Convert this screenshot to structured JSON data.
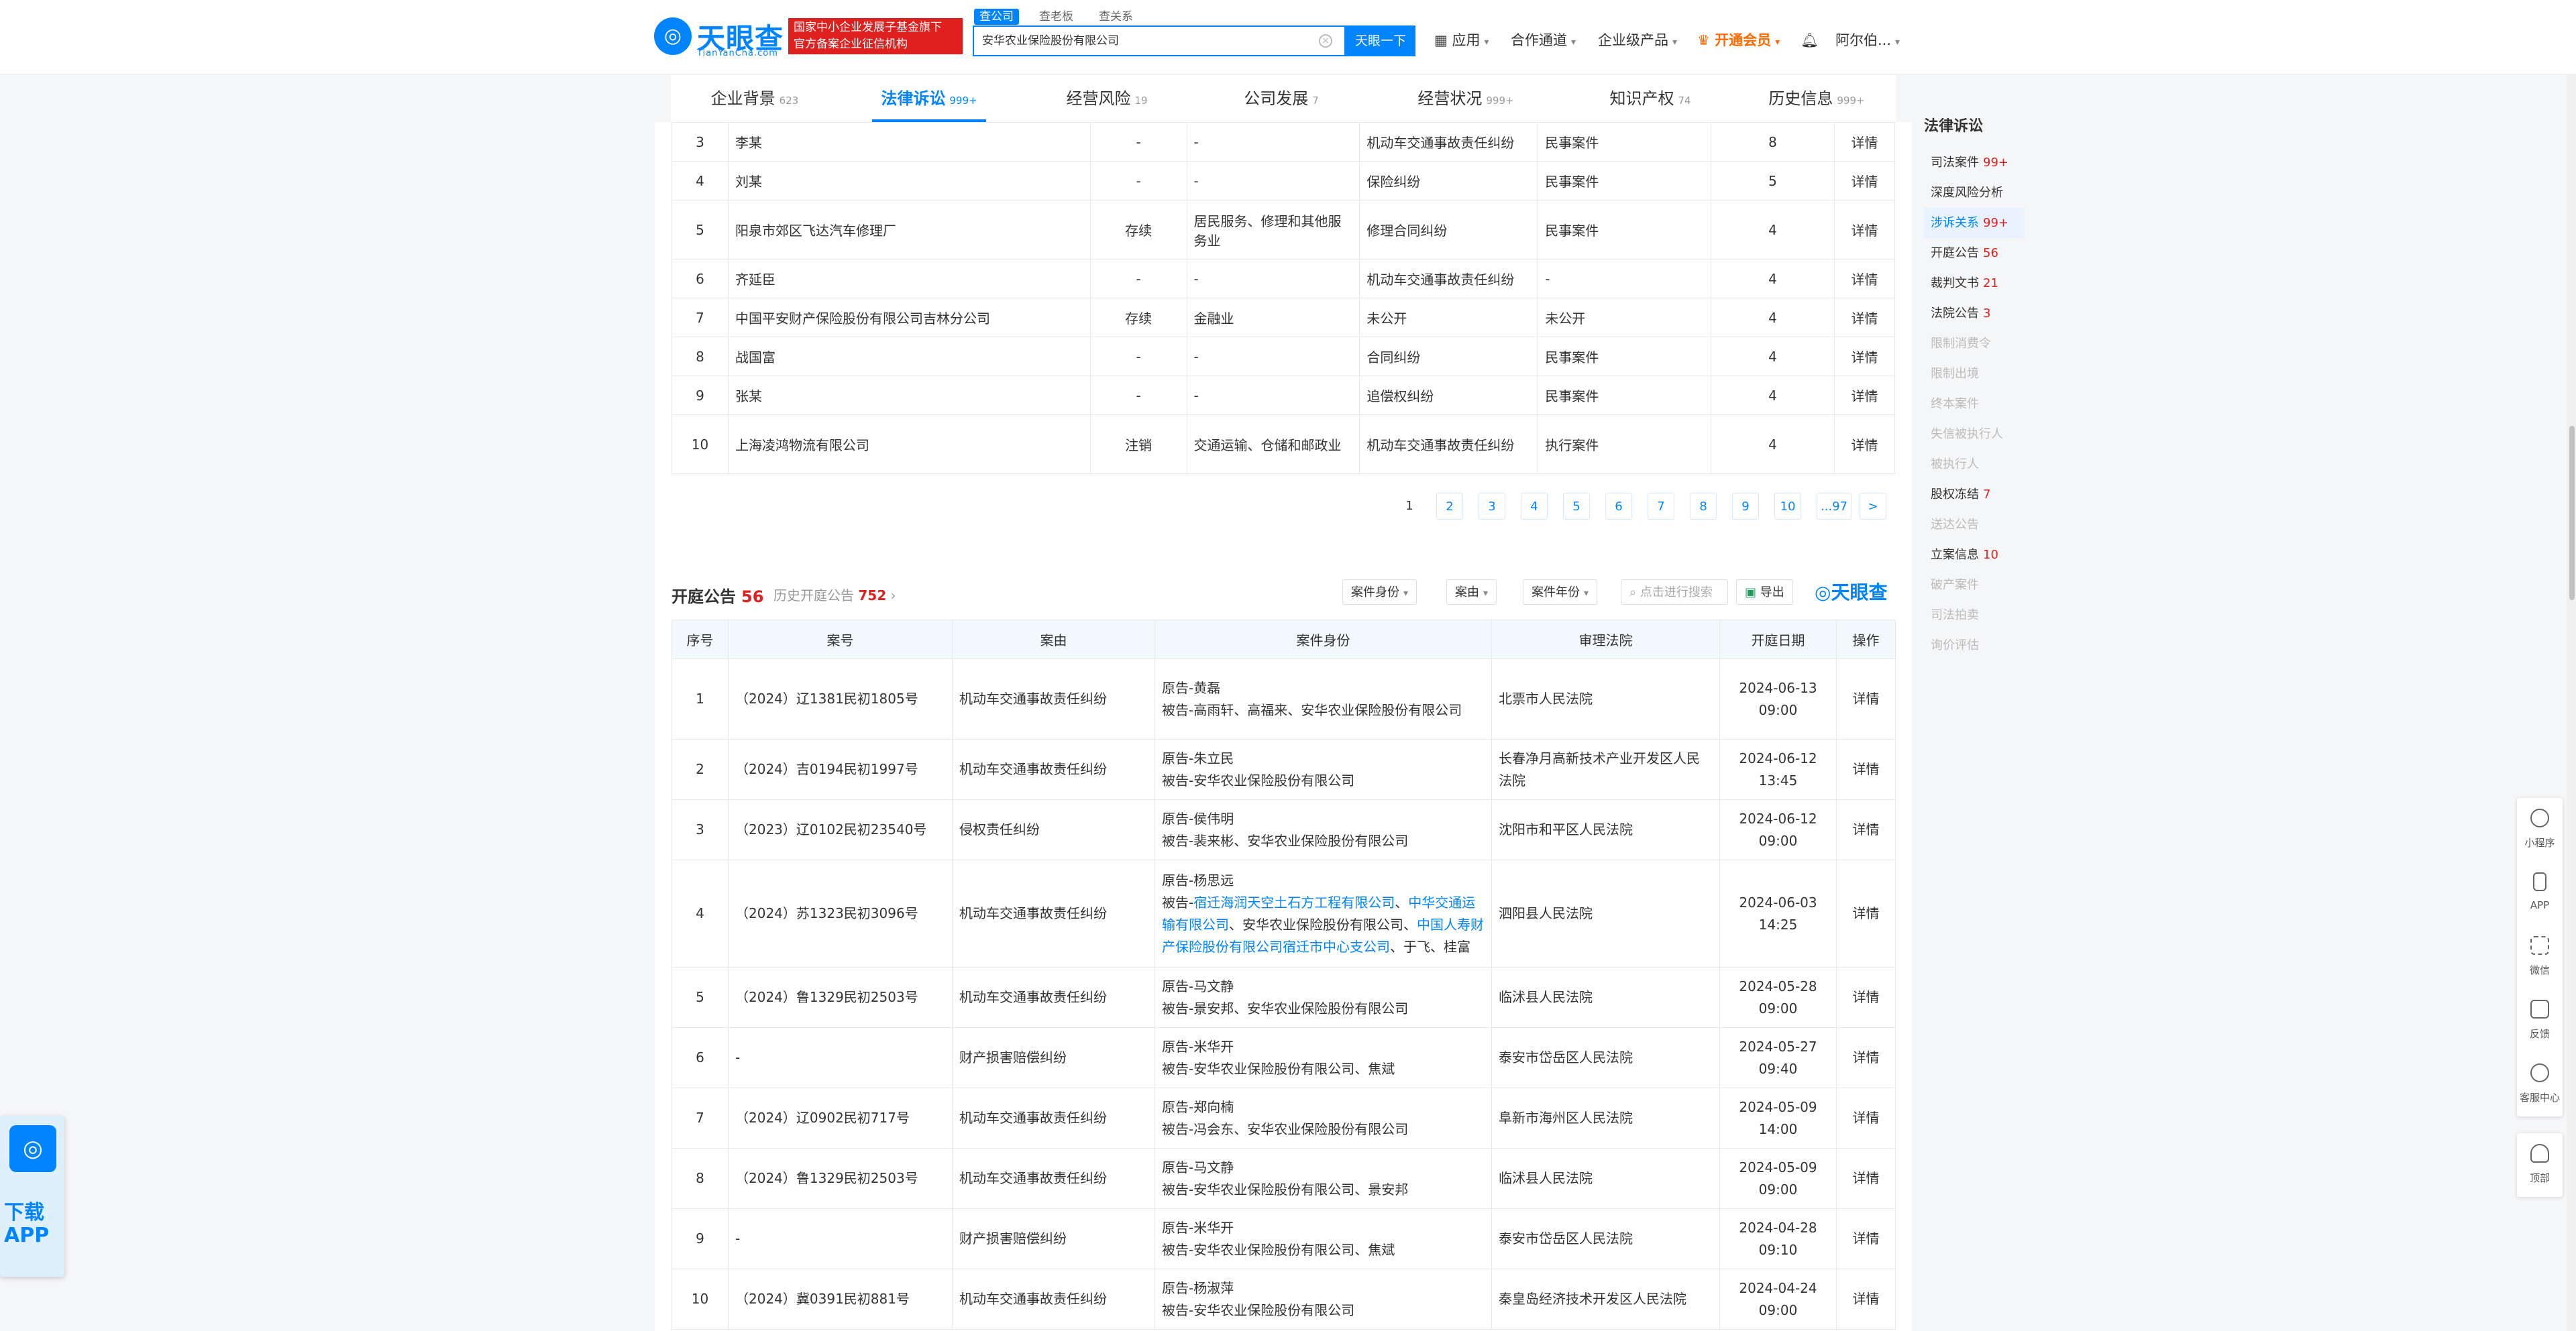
{
  "header": {
    "logo_text": "天眼查",
    "logo_sub": "TianYanCha.com",
    "gov_badge_line1": "国家中小企业发展子基金旗下",
    "gov_badge_line2": "官方备案企业征信机构",
    "search_tabs": [
      "查公司",
      "查老板",
      "查关系"
    ],
    "search_value": "安华农业保险股份有限公司",
    "search_button": "天眼一下",
    "nav": {
      "app": "应用",
      "cooperation": "合作通道",
      "enterprise": "企业级产品",
      "vip": "开通会员",
      "user": "阿尔伯..."
    }
  },
  "main_tabs": [
    {
      "label": "企业背景",
      "count": "623"
    },
    {
      "label": "法律诉讼",
      "count": "999+"
    },
    {
      "label": "经营风险",
      "count": "19"
    },
    {
      "label": "公司发展",
      "count": "7"
    },
    {
      "label": "经营状况",
      "count": "999+"
    },
    {
      "label": "知识产权",
      "count": "74"
    },
    {
      "label": "历史信息",
      "count": "999+"
    }
  ],
  "related_table": {
    "rows": [
      {
        "no": "3",
        "name": "李某",
        "status": "-",
        "industry": "-",
        "cause": "机动车交通事故责任纠纷",
        "type": "民事案件",
        "count": "8",
        "op": "详情"
      },
      {
        "no": "4",
        "name": "刘某",
        "status": "-",
        "industry": "-",
        "cause": "保险纠纷",
        "type": "民事案件",
        "count": "5",
        "op": "详情"
      },
      {
        "no": "5",
        "name": "阳泉市郊区飞达汽车修理厂",
        "status": "存续",
        "industry": "居民服务、修理和其他服务业",
        "cause": "修理合同纠纷",
        "type": "民事案件",
        "count": "4",
        "op": "详情"
      },
      {
        "no": "6",
        "name": "齐延臣",
        "status": "-",
        "industry": "-",
        "cause": "机动车交通事故责任纠纷",
        "type": "-",
        "count": "4",
        "op": "详情"
      },
      {
        "no": "7",
        "name": "中国平安财产保险股份有限公司吉林分公司",
        "status": "存续",
        "industry": "金融业",
        "cause": "未公开",
        "type": "未公开",
        "count": "4",
        "op": "详情"
      },
      {
        "no": "8",
        "name": "战国富",
        "status": "-",
        "industry": "-",
        "cause": "合同纠纷",
        "type": "民事案件",
        "count": "4",
        "op": "详情"
      },
      {
        "no": "9",
        "name": "张某",
        "status": "-",
        "industry": "-",
        "cause": "追偿权纠纷",
        "type": "民事案件",
        "count": "4",
        "op": "详情"
      },
      {
        "no": "10",
        "name": "上海凌鸿物流有限公司",
        "status": "注销",
        "industry": "交通运输、仓储和邮政业",
        "cause": "机动车交通事故责任纠纷",
        "type": "执行案件",
        "count": "4",
        "op": "详情"
      }
    ]
  },
  "pagination": [
    "1",
    "2",
    "3",
    "4",
    "5",
    "6",
    "7",
    "8",
    "9",
    "10",
    "...97",
    ">"
  ],
  "court_notice": {
    "title": "开庭公告",
    "count": "56",
    "history_label": "历史开庭公告",
    "history_count": "752",
    "filters": [
      "案件身份",
      "案由",
      "案件年份"
    ],
    "search_placeholder": "点击进行搜索",
    "export_label": "导出",
    "brand": "天眼查",
    "columns": [
      "序号",
      "案号",
      "案由",
      "案件身份",
      "审理法院",
      "开庭日期",
      "操作"
    ],
    "rows": [
      {
        "no": "1",
        "case_no": "（2024）辽1381民初1805号",
        "cause": "机动车交通事故责任纠纷",
        "plaintiff": "原告-黄磊",
        "defendant": "被告-高雨轩、高福来、安华农业保险股份有限公司",
        "court": "北票市人民法院",
        "date": "2024-06-13 09:00",
        "op": "详情"
      },
      {
        "no": "2",
        "case_no": "（2024）吉0194民初1997号",
        "cause": "机动车交通事故责任纠纷",
        "plaintiff": "原告-朱立民",
        "defendant": "被告-安华农业保险股份有限公司",
        "court": "长春净月高新技术产业开发区人民法院",
        "date": "2024-06-12 13:45",
        "op": "详情"
      },
      {
        "no": "3",
        "case_no": "（2023）辽0102民初23540号",
        "cause": "侵权责任纠纷",
        "plaintiff": "原告-侯伟明",
        "defendant": "被告-裴来彬、安华农业保险股份有限公司",
        "court": "沈阳市和平区人民法院",
        "date": "2024-06-12 09:00",
        "op": "详情"
      },
      {
        "no": "4",
        "case_no": "（2024）苏1323民初3096号",
        "cause": "机动车交通事故责任纠纷",
        "plaintiff": "原告-杨思远",
        "defendant_prefix": "被告-",
        "defendant_link1": "宿迁海润天空土石方工程有限公司",
        "sep1": "、",
        "defendant_link2": "中华交通运输有限公司",
        "defendant_mid": "、安华农业保险股份有限公司、",
        "defendant_link3": "中国人寿财产保险股份有限公司宿迁市中心支公司",
        "defendant_tail": "、于飞、桂富",
        "court": "泗阳县人民法院",
        "date": "2024-06-03 14:25",
        "op": "详情"
      },
      {
        "no": "5",
        "case_no": "（2024）鲁1329民初2503号",
        "cause": "机动车交通事故责任纠纷",
        "plaintiff": "原告-马文静",
        "defendant": "被告-景安邦、安华农业保险股份有限公司",
        "court": "临沭县人民法院",
        "date": "2024-05-28 09:00",
        "op": "详情"
      },
      {
        "no": "6",
        "case_no": "-",
        "cause": "财产损害赔偿纠纷",
        "plaintiff": "原告-米华开",
        "defendant": "被告-安华农业保险股份有限公司、焦斌",
        "court": "泰安市岱岳区人民法院",
        "date": "2024-05-27 09:40",
        "op": "详情"
      },
      {
        "no": "7",
        "case_no": "（2024）辽0902民初717号",
        "cause": "机动车交通事故责任纠纷",
        "plaintiff": "原告-郑向楠",
        "defendant": "被告-冯会东、安华农业保险股份有限公司",
        "court": "阜新市海州区人民法院",
        "date": "2024-05-09 14:00",
        "op": "详情"
      },
      {
        "no": "8",
        "case_no": "（2024）鲁1329民初2503号",
        "cause": "机动车交通事故责任纠纷",
        "plaintiff": "原告-马文静",
        "defendant": "被告-安华农业保险股份有限公司、景安邦",
        "court": "临沭县人民法院",
        "date": "2024-05-09 09:00",
        "op": "详情"
      },
      {
        "no": "9",
        "case_no": "-",
        "cause": "财产损害赔偿纠纷",
        "plaintiff": "原告-米华开",
        "defendant": "被告-安华农业保险股份有限公司、焦斌",
        "court": "泰安市岱岳区人民法院",
        "date": "2024-04-28 09:10",
        "op": "详情"
      },
      {
        "no": "10",
        "case_no": "（2024）冀0391民初881号",
        "cause": "机动车交通事故责任纠纷",
        "plaintiff": "原告-杨淑萍",
        "defendant": "被告-安华农业保险股份有限公司",
        "court": "秦皇岛经济技术开发区人民法院",
        "date": "2024-04-24 09:00",
        "op": "详情"
      }
    ]
  },
  "sidebar": {
    "title": "法律诉讼",
    "items": [
      {
        "label": "司法案件",
        "count": "99+",
        "state": "normal"
      },
      {
        "label": "深度风险分析",
        "count": "",
        "state": "normal"
      },
      {
        "label": "涉诉关系",
        "count": "99+",
        "state": "active"
      },
      {
        "label": "开庭公告",
        "count": "56",
        "state": "normal"
      },
      {
        "label": "裁判文书",
        "count": "21",
        "state": "normal"
      },
      {
        "label": "法院公告",
        "count": "3",
        "state": "normal"
      },
      {
        "label": "限制消费令",
        "count": "",
        "state": "disabled"
      },
      {
        "label": "限制出境",
        "count": "",
        "state": "disabled"
      },
      {
        "label": "终本案件",
        "count": "",
        "state": "disabled"
      },
      {
        "label": "失信被执行人",
        "count": "",
        "state": "disabled"
      },
      {
        "label": "被执行人",
        "count": "",
        "state": "disabled"
      },
      {
        "label": "股权冻结",
        "count": "7",
        "state": "normal"
      },
      {
        "label": "送达公告",
        "count": "",
        "state": "disabled"
      },
      {
        "label": "立案信息",
        "count": "10",
        "state": "normal"
      },
      {
        "label": "破产案件",
        "count": "",
        "state": "disabled"
      },
      {
        "label": "司法拍卖",
        "count": "",
        "state": "disabled"
      },
      {
        "label": "询价评估",
        "count": "",
        "state": "disabled"
      }
    ]
  },
  "right_tools": [
    "小程序",
    "APP",
    "微信",
    "反馈",
    "客服中心",
    "顶部"
  ],
  "download_app": {
    "line1": "下载",
    "line2": "APP"
  },
  "colors": {
    "brand": "#0084ff",
    "danger": "#e0201f",
    "alive": "#1aa05c"
  }
}
